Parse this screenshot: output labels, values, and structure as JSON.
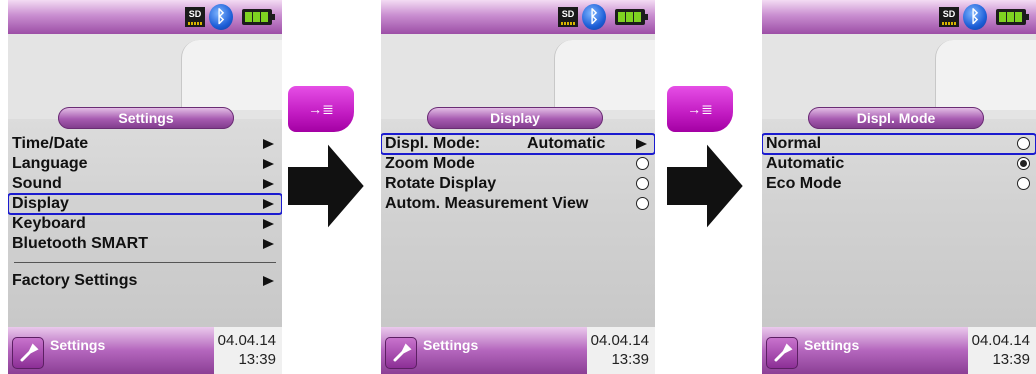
{
  "status": {
    "sd_label": "SD",
    "bluetooth_glyph": "ᛒ",
    "battery_icon": "battery-icon"
  },
  "colors": {
    "accent": "#a84fb3",
    "highlight": "#1b1bcf",
    "key_button": "#c21bc2"
  },
  "key_button": {
    "glyph": "→≣"
  },
  "screens": [
    {
      "title": "Settings",
      "items": [
        {
          "label": "Time/Date"
        },
        {
          "label": "Language"
        },
        {
          "label": "Sound"
        },
        {
          "label": "Display",
          "selected": true
        },
        {
          "label": "Keyboard"
        },
        {
          "label": "Bluetooth SMART"
        },
        {
          "label": "Factory Settings"
        }
      ],
      "bottom_label": "Settings",
      "date": "04.04.14",
      "time": "13:39"
    },
    {
      "title": "Display",
      "items": [
        {
          "label": "Displ. Mode:",
          "value": "Automatic",
          "selected": true
        },
        {
          "label": "Zoom Mode"
        },
        {
          "label": "Rotate Display"
        },
        {
          "label": "Autom. Measurement View"
        }
      ],
      "bottom_label": "Settings",
      "date": "04.04.14",
      "time": "13:39"
    },
    {
      "title": "Displ. Mode",
      "items": [
        {
          "label": "Normal",
          "selected": true,
          "checked": false
        },
        {
          "label": "Automatic",
          "checked": true
        },
        {
          "label": "Eco Mode",
          "checked": false
        }
      ],
      "bottom_label": "Settings",
      "date": "04.04.14",
      "time": "13:39"
    }
  ]
}
